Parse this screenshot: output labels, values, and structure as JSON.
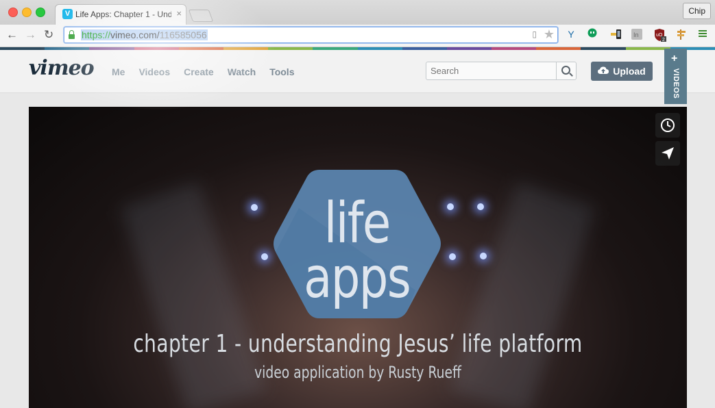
{
  "browser": {
    "tab_title": "Life Apps: Chapter 1 - Und",
    "tab_favicon": "V",
    "tab_close": "×",
    "profile": "Chip",
    "url_scheme": "https://",
    "url_host": "vimeo.com/",
    "url_path": "116585056"
  },
  "vimeo": {
    "logo": "vimeo",
    "nav": [
      "Me",
      "Videos",
      "Create",
      "Watch",
      "Tools"
    ],
    "search_placeholder": "Search",
    "upload_label": "Upload",
    "side_tab_plus": "+",
    "side_tab_label": "VIDEOS"
  },
  "video": {
    "logo_line1": "life",
    "logo_line2": "apps",
    "chapter_title": "chapter 1 - understanding Jesus’ life platform",
    "byline": "video application by Rusty Rueff"
  },
  "colors": {
    "vimeo_blue": "#1ab7ea",
    "hex_blue": "#5b87b2",
    "upload_bg": "#5c6e7e"
  }
}
